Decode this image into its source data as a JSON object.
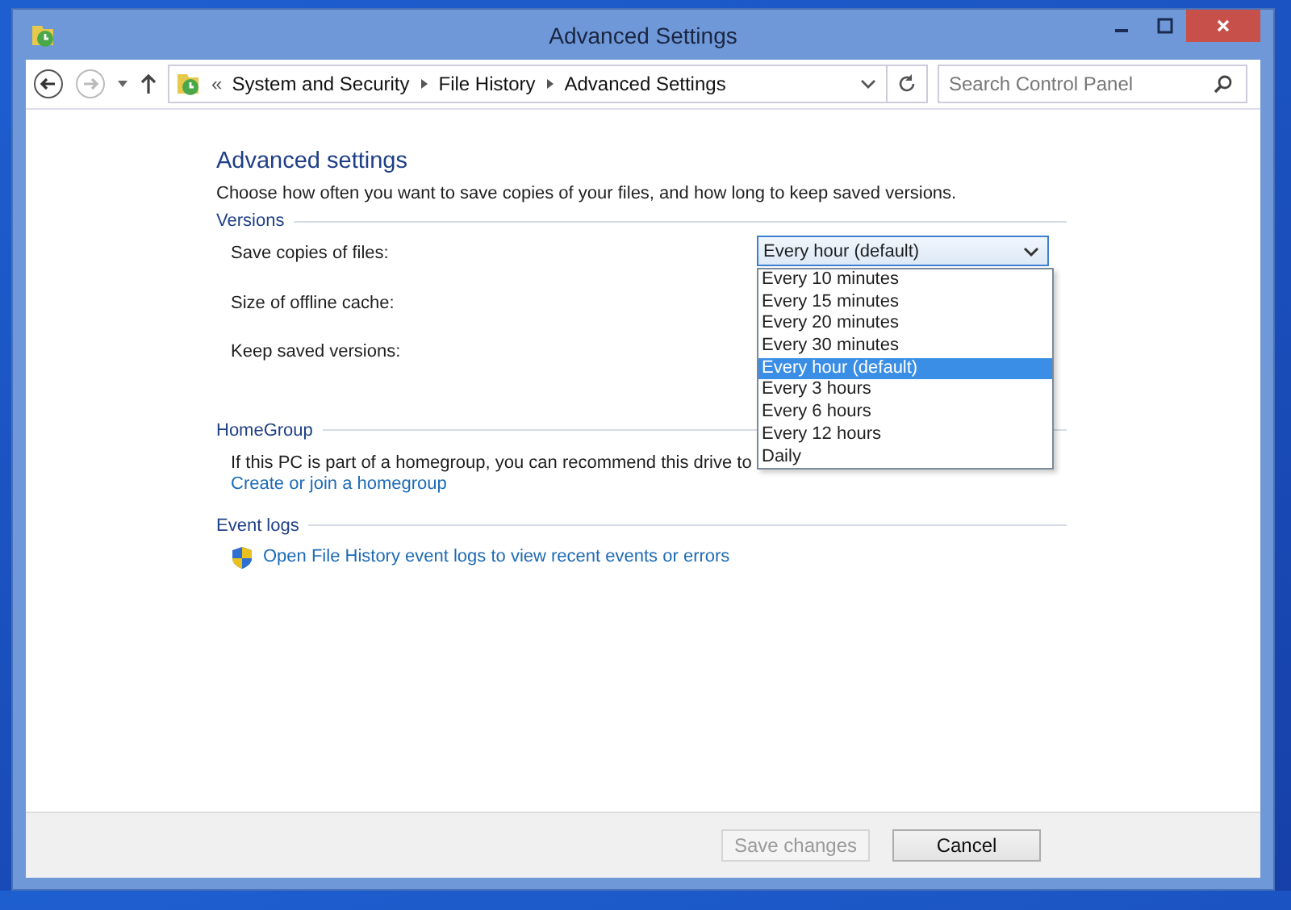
{
  "window": {
    "title": "Advanced Settings"
  },
  "address_bar": {
    "overflow": "«",
    "breadcrumbs": [
      "System and Security",
      "File History",
      "Advanced Settings"
    ]
  },
  "search": {
    "placeholder": "Search Control Panel"
  },
  "heading": "Advanced settings",
  "description": "Choose how often you want to save copies of your files, and how long to keep saved versions.",
  "versions": {
    "title": "Versions",
    "settings": [
      "Save copies of files:",
      "Size of offline cache:",
      "Keep saved versions:"
    ],
    "dropdown": {
      "value": "Every hour (default)",
      "expanded": true,
      "options": [
        {
          "label": "Every 10 minutes",
          "selected": false
        },
        {
          "label": "Every 15 minutes",
          "selected": false
        },
        {
          "label": "Every 20 minutes",
          "selected": false
        },
        {
          "label": "Every 30 minutes",
          "selected": false
        },
        {
          "label": "Every hour (default)",
          "selected": true
        },
        {
          "label": "Every 3 hours",
          "selected": false
        },
        {
          "label": "Every 6 hours",
          "selected": false
        },
        {
          "label": "Every 12 hours",
          "selected": false
        },
        {
          "label": "Daily",
          "selected": false
        }
      ]
    }
  },
  "homegroup": {
    "title": "HomeGroup",
    "text": "If this PC is part of a homegroup, you can recommend this drive to",
    "link": "Create or join a homegroup"
  },
  "event_logs": {
    "title": "Event logs",
    "link": "Open File History event logs to view recent events or errors"
  },
  "buttons": [
    {
      "label": "Save changes",
      "disabled": true
    },
    {
      "label": "Cancel",
      "disabled": false
    }
  ]
}
